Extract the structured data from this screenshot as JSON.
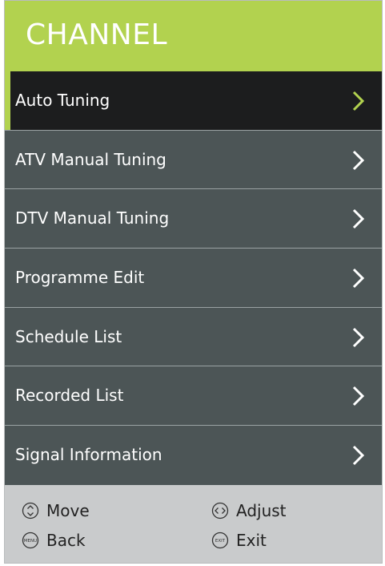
{
  "header": {
    "title": "CHANNEL"
  },
  "menu": {
    "items": [
      {
        "label": "Auto Tuning"
      },
      {
        "label": "ATV Manual Tuning"
      },
      {
        "label": "DTV Manual Tuning"
      },
      {
        "label": "Programme Edit"
      },
      {
        "label": "Schedule List"
      },
      {
        "label": "Recorded List"
      },
      {
        "label": "Signal Information"
      }
    ],
    "selected_index": 0
  },
  "footer": {
    "move": {
      "label": "Move",
      "icon": "up-down-arrows-icon"
    },
    "adjust": {
      "label": "Adjust",
      "icon": "left-right-arrows-icon"
    },
    "back": {
      "label": "Back",
      "icon": "menu-button-icon",
      "icon_text": "MENU"
    },
    "exit": {
      "label": "Exit",
      "icon": "exit-button-icon",
      "icon_text": "EXIT"
    }
  },
  "colors": {
    "accent": "#b2d24f",
    "panel": "#4c5556",
    "selected": "#1c1d1e",
    "footer": "#c9cbcc"
  }
}
